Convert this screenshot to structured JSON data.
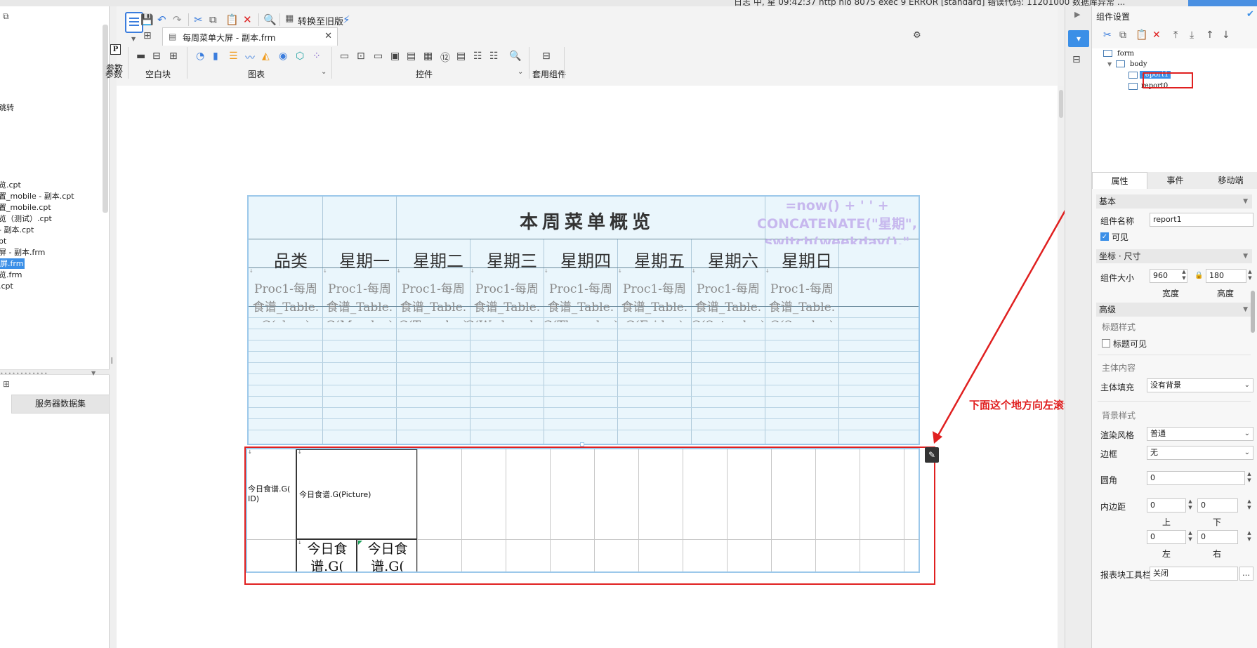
{
  "topstrip": {
    "status": "日志 中, 星 09:42:37 http nio 8075 exec 9 ERROR [standard] 错误代码: 11201000 数据库异常 ..."
  },
  "leftpanel": {
    "items": [
      {
        "label": "跳转"
      },
      {
        "label": "览.cpt"
      },
      {
        "label": "置_mobile - 副本.cpt"
      },
      {
        "label": "置_mobile.cpt"
      },
      {
        "label": "览（测试）.cpt"
      },
      {
        "label": "- 副本.cpt"
      },
      {
        "label": "pt"
      },
      {
        "label": "屏 - 副本.frm"
      },
      {
        "label": "屏.frm"
      },
      {
        "label": "览.frm"
      },
      {
        "label": ".cpt"
      }
    ],
    "datasource_tab": "服务器数据集"
  },
  "toolbar": {
    "convert_label": "转换至旧版",
    "tab_label": "每周菜单大屏 - 副本.frm",
    "groups": {
      "param": "参数",
      "blank": "空白块",
      "chart": "图表",
      "control": "控件",
      "template": "套用组件"
    }
  },
  "report0": {
    "title": "本周菜单概览",
    "formula_lines": [
      "=now() + '    ' +",
      "CONCATENATE(\"星期\",",
      "switch(weekday(),\""
    ],
    "headers": [
      "品类",
      "星期一",
      "星期二",
      "星期三",
      "星期四",
      "星期五",
      "星期六",
      "星期日"
    ],
    "cells": [
      [
        "Proc1-每周",
        "食谱_Table.",
        "G(class)"
      ],
      [
        "Proc1-每周",
        "食谱_Table.",
        "G(Monday)"
      ],
      [
        "Proc1-每周",
        "食谱_Table.",
        "G(Tuesday)"
      ],
      [
        "Proc1-每周",
        "食谱_Table.",
        "G(Wednesday)"
      ],
      [
        "Proc1-每周",
        "食谱_Table.",
        "G(Thursday)"
      ],
      [
        "Proc1-每周",
        "食谱_Table.",
        "G(Friday)"
      ],
      [
        "Proc1-每周",
        "食谱_Table.",
        "G(Saturday)"
      ],
      [
        "Proc1-每周",
        "食谱_Table.",
        "G(Sunday)"
      ]
    ]
  },
  "report1": {
    "id_cell": [
      "今日食谱.G(",
      "ID)"
    ],
    "picture_cell": "今日食谱.G(Picture)",
    "big_cell_a": [
      "今日食",
      "谱.G("
    ],
    "big_cell_b": [
      "今日食",
      "谱.G("
    ]
  },
  "annotation": {
    "text": "下面这个地方向左滚动就行"
  },
  "rightpanel": {
    "title": "组件设置",
    "tree": {
      "form": "form",
      "body": "body",
      "report1": "report1",
      "report0": "report0"
    },
    "tabs": [
      "属性",
      "事件",
      "移动端"
    ],
    "sections": {
      "basic": "基本",
      "size": "坐标 · 尺寸",
      "advanced": "高级"
    },
    "fields": {
      "name_label": "组件名称",
      "name_value": "report1",
      "visible_label": "可见",
      "size_label": "组件大小",
      "width_value": "960",
      "height_value": "180",
      "width_caption": "宽度",
      "height_caption": "高度",
      "title_style": "标题样式",
      "title_visible": "标题可见",
      "body_content": "主体内容",
      "body_fill_label": "主体填充",
      "body_fill_value": "没有背景",
      "bg_style": "背景样式",
      "render_label": "渲染风格",
      "render_value": "普通",
      "border_label": "边框",
      "border_value": "无",
      "radius_label": "圆角",
      "radius_value": "0",
      "padding_label": "内边距",
      "pad_top": "0",
      "pad_bottom": "0",
      "pad_left": "0",
      "pad_right": "0",
      "cap_top": "上",
      "cap_bottom": "下",
      "cap_left": "左",
      "cap_right": "右",
      "toolbar_label": "报表块工具栏",
      "toolbar_value": "关闭"
    }
  },
  "colors": {
    "accent": "#3b8fe7",
    "annotation": "#e02020",
    "formula": "#c7b8ee"
  }
}
